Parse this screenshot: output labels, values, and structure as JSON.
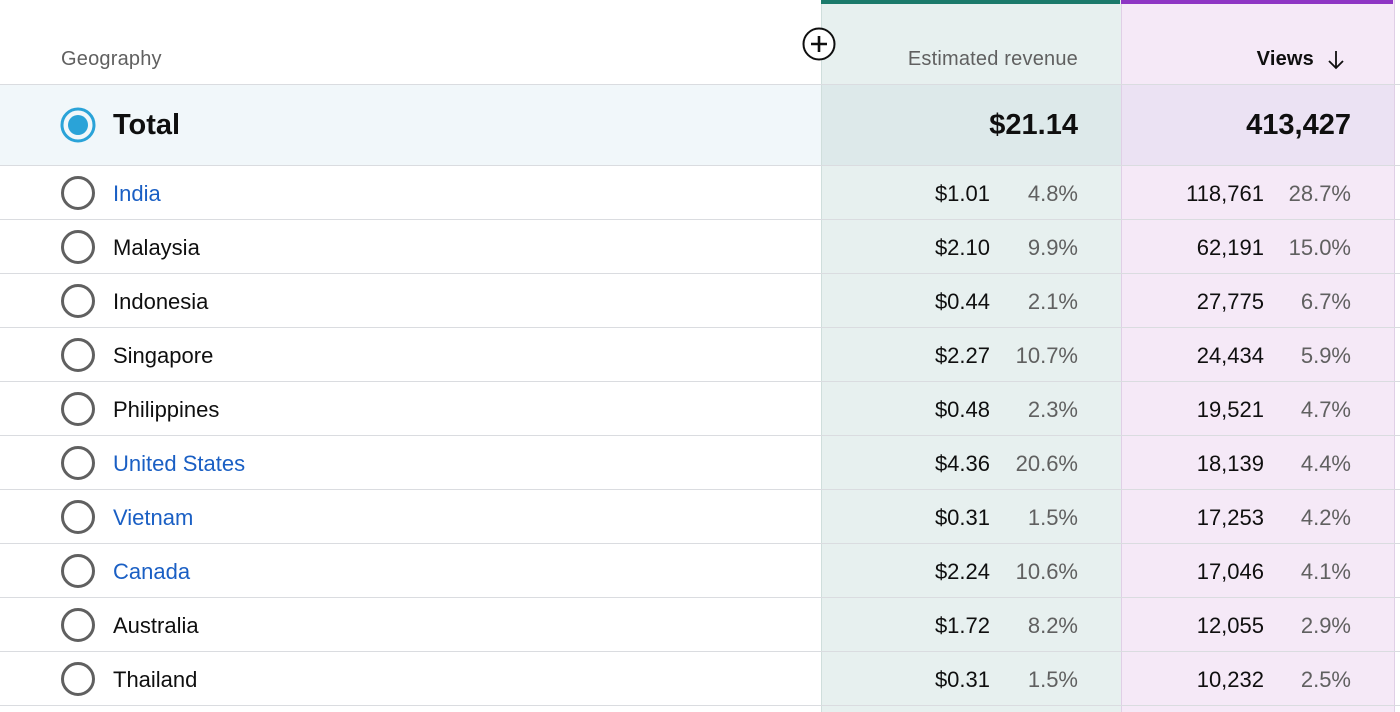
{
  "header": {
    "geography_label": "Geography",
    "revenue_label": "Estimated revenue",
    "views_label": "Views"
  },
  "total": {
    "label": "Total",
    "revenue": "$21.14",
    "views": "413,427"
  },
  "rows": [
    {
      "name": "India",
      "link": true,
      "revenue": "$1.01",
      "revenue_pct": "4.8%",
      "views": "118,761",
      "views_pct": "28.7%"
    },
    {
      "name": "Malaysia",
      "link": false,
      "revenue": "$2.10",
      "revenue_pct": "9.9%",
      "views": "62,191",
      "views_pct": "15.0%"
    },
    {
      "name": "Indonesia",
      "link": false,
      "revenue": "$0.44",
      "revenue_pct": "2.1%",
      "views": "27,775",
      "views_pct": "6.7%"
    },
    {
      "name": "Singapore",
      "link": false,
      "revenue": "$2.27",
      "revenue_pct": "10.7%",
      "views": "24,434",
      "views_pct": "5.9%"
    },
    {
      "name": "Philippines",
      "link": false,
      "revenue": "$0.48",
      "revenue_pct": "2.3%",
      "views": "19,521",
      "views_pct": "4.7%"
    },
    {
      "name": "United States",
      "link": true,
      "revenue": "$4.36",
      "revenue_pct": "20.6%",
      "views": "18,139",
      "views_pct": "4.4%"
    },
    {
      "name": "Vietnam",
      "link": true,
      "revenue": "$0.31",
      "revenue_pct": "1.5%",
      "views": "17,253",
      "views_pct": "4.2%"
    },
    {
      "name": "Canada",
      "link": true,
      "revenue": "$2.24",
      "revenue_pct": "10.6%",
      "views": "17,046",
      "views_pct": "4.1%"
    },
    {
      "name": "Australia",
      "link": false,
      "revenue": "$1.72",
      "revenue_pct": "8.2%",
      "views": "12,055",
      "views_pct": "2.9%"
    },
    {
      "name": "Thailand",
      "link": false,
      "revenue": "$0.31",
      "revenue_pct": "1.5%",
      "views": "10,232",
      "views_pct": "2.5%"
    }
  ],
  "colors": {
    "revenue_accent": "#1b7a6b",
    "views_accent": "#8e35c4",
    "radio_selected": "#2aa3d8",
    "link": "#1a5fc4"
  },
  "icons": {
    "sort": "arrow-down-icon",
    "add_column": "plus-circle-icon",
    "radio": "radio-icon"
  }
}
